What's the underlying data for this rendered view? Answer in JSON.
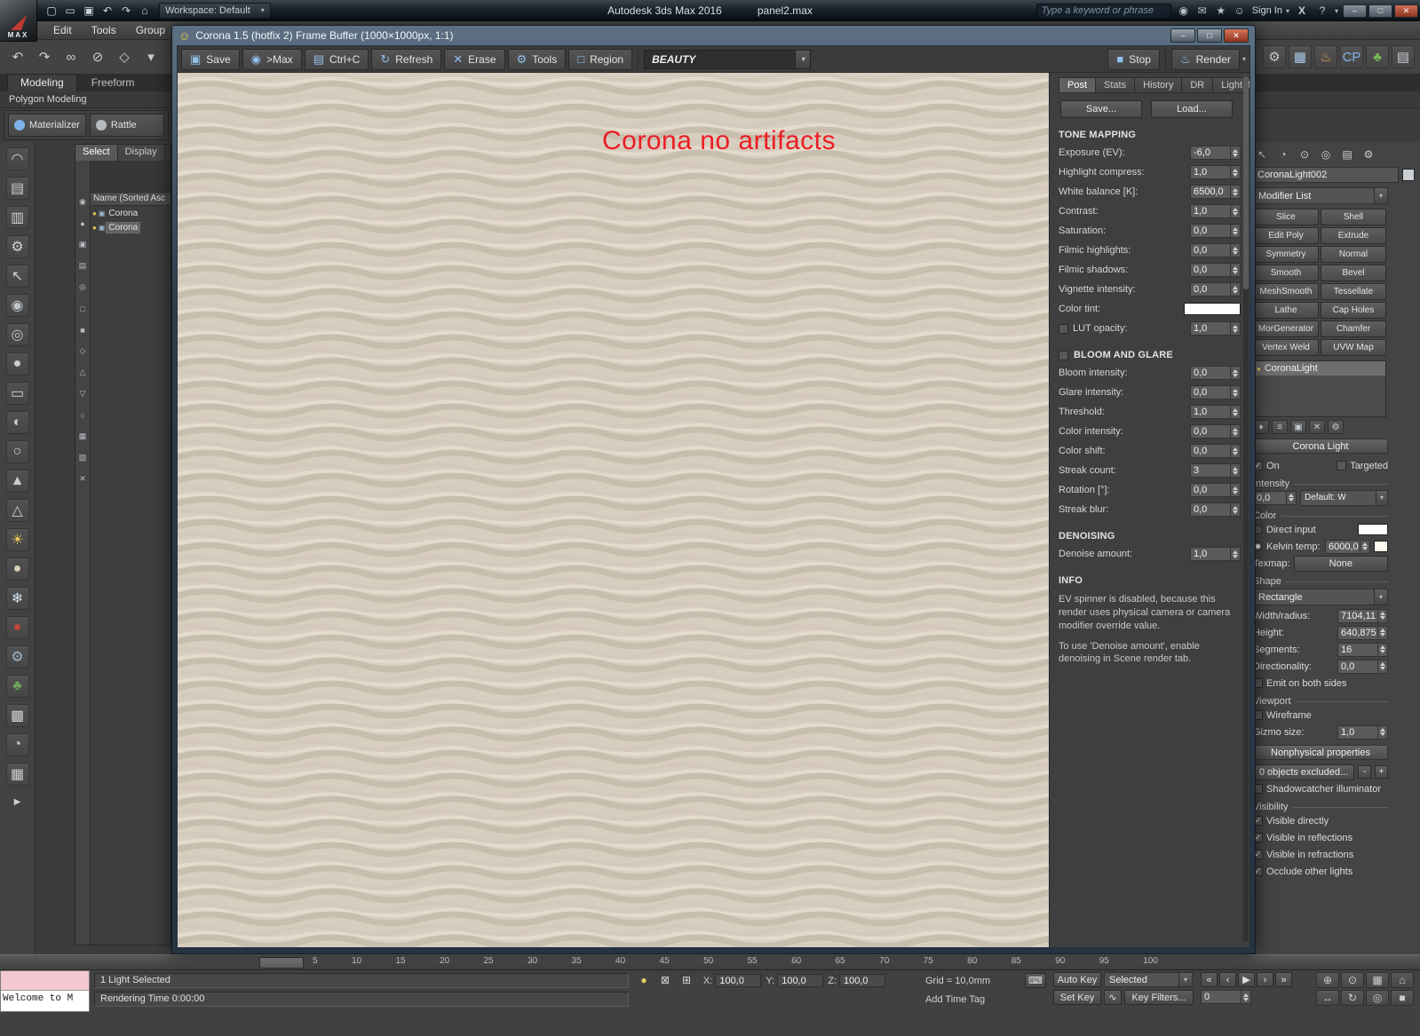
{
  "titlebar": {
    "logo": "MAX",
    "workspace_label": "Workspace: Default",
    "app_title": "Autodesk 3ds Max 2016",
    "doc_title": "panel2.max",
    "search_placeholder": "Type a keyword or phrase",
    "sign_in": "Sign In",
    "exchange": "X",
    "help": "?",
    "qat_icons": [
      {
        "name": "new-file-icon",
        "glyph": "▢"
      },
      {
        "name": "open-file-icon",
        "glyph": "▭"
      },
      {
        "name": "save-file-icon",
        "glyph": "▣"
      },
      {
        "name": "undo-icon",
        "glyph": "↶"
      },
      {
        "name": "redo-icon",
        "glyph": "↷"
      },
      {
        "name": "project-folder-icon",
        "glyph": "⌂"
      }
    ],
    "right_icons": [
      {
        "name": "search-icon",
        "glyph": "◉"
      },
      {
        "name": "communication-center-icon",
        "glyph": "✉"
      },
      {
        "name": "favorites-icon",
        "glyph": "★"
      },
      {
        "name": "user-icon",
        "glyph": "☺"
      }
    ],
    "window_buttons": [
      {
        "name": "app-minimize-button",
        "glyph": "–"
      },
      {
        "name": "app-maximize-button",
        "glyph": "□"
      },
      {
        "name": "app-close-button",
        "glyph": "✕",
        "close": true
      }
    ]
  },
  "menubar": {
    "items": [
      {
        "label": "Edit"
      },
      {
        "label": "Tools"
      },
      {
        "label": "Group"
      }
    ]
  },
  "toolbar": {
    "left_icons": [
      {
        "name": "undo-icon",
        "glyph": "↶"
      },
      {
        "name": "redo-icon",
        "glyph": "↷"
      },
      {
        "name": "select-and-link-icon",
        "glyph": "∞"
      },
      {
        "name": "unlink-selection-icon",
        "glyph": "⊘"
      },
      {
        "name": "bind-to-spacewarp-icon",
        "glyph": "◇"
      },
      {
        "name": "selection-filter-icon",
        "glyph": "▾"
      }
    ],
    "right_icons": [
      {
        "name": "render-setup-icon",
        "glyph": "⚙",
        "color": "#bfc7cd"
      },
      {
        "name": "rendered-frame-window-icon",
        "glyph": "▦",
        "color": "#a8c9e8"
      },
      {
        "name": "render-production-icon",
        "glyph": "♨",
        "color": "#e0a54c"
      },
      {
        "name": "cp-icon",
        "glyph": "CP",
        "color": "#7fb3e8"
      },
      {
        "name": "environment-icon",
        "glyph": "♣",
        "color": "#74b35a"
      },
      {
        "name": "layer-manager-icon",
        "glyph": "▤",
        "color": "#c9ced2"
      }
    ]
  },
  "ribbon": {
    "tabs": [
      {
        "label": "Modeling",
        "active": true
      },
      {
        "label": "Freeform",
        "active": false
      }
    ],
    "section_label": "Polygon Modeling",
    "tools": [
      {
        "label": "Materializer",
        "color": "#7fb3e8"
      },
      {
        "label": "Rattle",
        "color": "#b8bcc0"
      }
    ]
  },
  "left_toolbar": {
    "expander": "▶",
    "icons": [
      {
        "name": "tool-icon-arc",
        "glyph": "◠",
        "color": "#cfcfcf"
      },
      {
        "name": "tool-icon-panel",
        "glyph": "▤",
        "color": "#cfcfcf"
      },
      {
        "name": "tool-icon-sheet",
        "glyph": "▥",
        "color": "#cfcfcf"
      },
      {
        "name": "tool-icon-gear",
        "glyph": "⚙",
        "color": "#cfcfcf"
      },
      {
        "name": "tool-icon-cursor",
        "glyph": "↖",
        "color": "#cfcfcf"
      },
      {
        "name": "tool-icon-sphere",
        "glyph": "◉",
        "color": "#bfc6cc"
      },
      {
        "name": "tool-icon-ring",
        "glyph": "◎",
        "color": "#bfc6cc"
      },
      {
        "name": "tool-icon-ball",
        "glyph": "●",
        "color": "#c8cdd2"
      },
      {
        "name": "tool-icon-box",
        "glyph": "▭",
        "color": "#cfcfcf"
      },
      {
        "name": "tool-icon-half-sphere",
        "glyph": "◐",
        "color": "#c8cdd2"
      },
      {
        "name": "tool-icon-circle",
        "glyph": "○",
        "color": "#cfcfcf"
      },
      {
        "name": "tool-icon-pyramid",
        "glyph": "▲",
        "color": "#c8cdd2"
      },
      {
        "name": "tool-icon-cone",
        "glyph": "△",
        "color": "#cfcfcf"
      },
      {
        "name": "tool-icon-sun",
        "glyph": "☀",
        "color": "#e6c75a"
      },
      {
        "name": "tool-icon-sand-sphere",
        "glyph": "●",
        "color": "#d9cfb6"
      },
      {
        "name": "tool-icon-snow",
        "glyph": "❄",
        "color": "#cfe2f2"
      },
      {
        "name": "tool-icon-red-sphere",
        "glyph": "●",
        "color": "#c2463a"
      },
      {
        "name": "tool-icon-gear2",
        "glyph": "⚙",
        "color": "#9fb5c6"
      },
      {
        "name": "tool-icon-plant",
        "glyph": "♣",
        "color": "#6da45a"
      },
      {
        "name": "tool-icon-grid",
        "glyph": "▩",
        "color": "#cfcfcf"
      },
      {
        "name": "tool-icon-clock",
        "glyph": "◔",
        "color": "#cfcfcf"
      },
      {
        "name": "tool-icon-cells",
        "glyph": "▦",
        "color": "#cfcfcf"
      }
    ]
  },
  "scene_explorer": {
    "tabs": [
      {
        "label": "Select",
        "active": true
      },
      {
        "label": "Display",
        "active": false
      }
    ],
    "column_header": "Name (Sorted Asc",
    "strip_icons": [
      {
        "name": "explorer-filter-icon-1",
        "glyph": "◉"
      },
      {
        "name": "explorer-filter-icon-2",
        "glyph": "●"
      },
      {
        "name": "explorer-filter-icon-3",
        "glyph": "▣"
      },
      {
        "name": "explorer-filter-icon-4",
        "glyph": "▤"
      },
      {
        "name": "explorer-filter-icon-5",
        "glyph": "◎"
      },
      {
        "name": "explorer-filter-icon-6",
        "glyph": "□"
      },
      {
        "name": "explorer-filter-icon-7",
        "glyph": "■"
      },
      {
        "name": "explorer-filter-icon-8",
        "glyph": "◇"
      },
      {
        "name": "explorer-filter-icon-9",
        "glyph": "△"
      },
      {
        "name": "explorer-filter-icon-10",
        "glyph": "▽"
      },
      {
        "name": "explorer-filter-icon-11",
        "glyph": "○"
      },
      {
        "name": "explorer-filter-icon-12",
        "glyph": "▦"
      },
      {
        "name": "explorer-filter-icon-13",
        "glyph": "▧"
      },
      {
        "name": "explorer-filter-icon-14",
        "glyph": "✕"
      }
    ],
    "rows": [
      {
        "label": "Corona",
        "selected": false
      },
      {
        "label": "Corona",
        "selected": true
      }
    ]
  },
  "vfb": {
    "title": "Corona 1.5 (hotfix 2) Frame Buffer (1000×1000px, 1:1)",
    "window_icon": "☺",
    "window_buttons": [
      {
        "name": "vfb-minimize-button",
        "glyph": "–"
      },
      {
        "name": "vfb-maximize-button",
        "glyph": "□"
      },
      {
        "name": "vfb-close-button",
        "glyph": "✕",
        "close": true
      }
    ],
    "toolbar_buttons": [
      {
        "name": "save-button",
        "label": "Save",
        "glyph": "▣"
      },
      {
        "name": "send-to-max-button",
        "label": ">Max",
        "glyph": "◉"
      },
      {
        "name": "copy-button",
        "label": "Ctrl+C",
        "glyph": "▤"
      },
      {
        "name": "refresh-button",
        "label": "Refresh",
        "glyph": "↻"
      },
      {
        "name": "erase-button",
        "label": "Erase",
        "glyph": "✕"
      },
      {
        "name": "tools-button",
        "label": "Tools",
        "glyph": "⚙"
      },
      {
        "name": "region-button",
        "label": "Region",
        "glyph": "□"
      }
    ],
    "channel_value": "BEAUTY",
    "stop_label": "Stop",
    "render_label": "Render",
    "overlay_text": "Corona no artifacts",
    "tabs": [
      {
        "label": "Post",
        "active": true
      },
      {
        "label": "Stats",
        "active": false
      },
      {
        "label": "History",
        "active": false
      },
      {
        "label": "DR",
        "active": false
      },
      {
        "label": "LightMix",
        "active": false
      }
    ],
    "post": {
      "save_button": "Save...",
      "load_button": "Load...",
      "tone_mapping": {
        "header": "TONE MAPPING",
        "rows": [
          {
            "label": "Exposure (EV):",
            "value": "-6,0"
          },
          {
            "label": "Highlight compress:",
            "value": "1,0"
          },
          {
            "label": "White balance [K]:",
            "value": "6500,0"
          },
          {
            "label": "Contrast:",
            "value": "1,0"
          },
          {
            "label": "Saturation:",
            "value": "0,0"
          },
          {
            "label": "Filmic highlights:",
            "value": "0,0"
          },
          {
            "label": "Filmic shadows:",
            "value": "0,0"
          },
          {
            "label": "Vignette intensity:",
            "value": "0,0"
          },
          {
            "label": "Color tint:",
            "is_color": true,
            "color": "#ffffff"
          },
          {
            "label": "LUT opacity:",
            "value": "1,0",
            "has_check": true
          }
        ]
      },
      "bloom_glare": {
        "header": "BLOOM AND GLARE",
        "rows": [
          {
            "label": "Bloom intensity:",
            "value": "0,0"
          },
          {
            "label": "Glare intensity:",
            "value": "0,0"
          },
          {
            "label": "Threshold:",
            "value": "1,0"
          },
          {
            "label": "Color intensity:",
            "value": "0,0"
          },
          {
            "label": "Color shift:",
            "value": "0,0"
          },
          {
            "label": "Streak count:",
            "value": "3"
          },
          {
            "label": "Rotation [°]:",
            "value": "0,0"
          },
          {
            "label": "Streak blur:",
            "value": "0,0"
          }
        ]
      },
      "denoising": {
        "header": "DENOISING",
        "rows": [
          {
            "label": "Denoise amount:",
            "value": "1,0"
          }
        ]
      },
      "info": {
        "header": "INFO",
        "paragraphs": [
          "EV spinner is disabled, because this render uses physical camera or camera modifier override value.",
          "To use 'Denoise amount', enable denoising in Scene render tab."
        ]
      }
    }
  },
  "command_panel": {
    "tab_icons": [
      {
        "name": "create-tab-icon",
        "glyph": "↖"
      },
      {
        "name": "modify-tab-icon",
        "glyph": "◔"
      },
      {
        "name": "hierarchy-tab-icon",
        "glyph": "⊙"
      },
      {
        "name": "motion-tab-icon",
        "glyph": "◎"
      },
      {
        "name": "display-tab-icon",
        "glyph": "▤"
      },
      {
        "name": "utilities-tab-icon",
        "glyph": "⚙"
      }
    ],
    "object_name": "CoronaLight002",
    "modifier_list_label": "Modifier List",
    "modifier_buttons": [
      {
        "label": "Slice"
      },
      {
        "label": "Shell"
      },
      {
        "label": "Edit Poly"
      },
      {
        "label": "Extrude"
      },
      {
        "label": "Symmetry"
      },
      {
        "label": "Normal"
      },
      {
        "label": "Smooth"
      },
      {
        "label": "Bevel"
      },
      {
        "label": "MeshSmooth"
      },
      {
        "label": "Tessellate"
      },
      {
        "label": "Lathe"
      },
      {
        "label": "Cap Holes"
      },
      {
        "label": "MorGenerator"
      },
      {
        "label": "Chamfer"
      },
      {
        "label": "Vertex Weld"
      },
      {
        "label": "UVW Map"
      }
    ],
    "stack_items": [
      {
        "label": "CoronaLight",
        "selected": true
      }
    ],
    "stack_tool_icons": [
      {
        "name": "pin-stack-icon",
        "glyph": "♦"
      },
      {
        "name": "show-end-result-icon",
        "glyph": "≡"
      },
      {
        "name": "make-unique-icon",
        "glyph": "▣"
      },
      {
        "name": "remove-modifier-icon",
        "glyph": "✕"
      },
      {
        "name": "configure-modifier-sets-icon",
        "glyph": "⚙"
      }
    ],
    "light": {
      "title": "Corona Light",
      "on_label": "On",
      "on_checked": true,
      "targeted_label": "Targeted",
      "targeted_checked": false,
      "intensity_label": "Intensity",
      "intensity_value": "0,0",
      "intensity_unit": "Default: W",
      "color_label": "Color",
      "direct_input_label": "Direct input",
      "direct_color": "#ffffff",
      "kelvin_label": "Kelvin temp:",
      "kelvin_value": "6000,0",
      "kelvin_color": "#fff8ee",
      "texmap_label": "Texmap:",
      "texmap_button": "None",
      "shape_label": "Shape",
      "shape_value": "Rectangle",
      "shape_fields": [
        {
          "label": "Width/radius:",
          "value": "7104,11"
        },
        {
          "label": "Height:",
          "value": "640,875"
        },
        {
          "label": "Segments:",
          "value": "16"
        },
        {
          "label": "Directionality:",
          "value": "0,0"
        }
      ],
      "emit_label": "Emit on both sides",
      "emit_checked": false,
      "viewport_label": "Viewport",
      "wireframe_label": "Wireframe",
      "wireframe_checked": false,
      "gizmo_label": "Gizmo size:",
      "gizmo_value": "1,0"
    },
    "nonphysical": {
      "title": "Nonphysical properties",
      "exclude_button": "0 objects excluded...",
      "shadowcatcher_label": "Shadowcatcher illuminator",
      "shadowcatcher_checked": false
    },
    "visibility": {
      "title": "Visibility",
      "options": [
        {
          "label": "Visible directly",
          "checked": true
        },
        {
          "label": "Visible in reflections",
          "checked": true
        },
        {
          "label": "Visible in refractions",
          "checked": true
        },
        {
          "label": "Occlude other lights",
          "checked": true
        }
      ]
    }
  },
  "timeline": {
    "ticks": [
      {
        "label": "5"
      },
      {
        "label": "10"
      },
      {
        "label": "15"
      },
      {
        "label": "20"
      },
      {
        "label": "25"
      },
      {
        "label": "30"
      },
      {
        "label": "35"
      },
      {
        "label": "40"
      },
      {
        "label": "45"
      },
      {
        "label": "50"
      },
      {
        "label": "55"
      },
      {
        "label": "60"
      },
      {
        "label": "65"
      },
      {
        "label": "70"
      },
      {
        "label": "75"
      },
      {
        "label": "80"
      },
      {
        "label": "85"
      },
      {
        "label": "90"
      },
      {
        "label": "95"
      },
      {
        "label": "100"
      }
    ]
  },
  "statusbar": {
    "listener_text": "Welcome to M",
    "selection_status": "1 Light Selected",
    "prompt_line": "Rendering Time  0:00:00",
    "status_icons": [
      {
        "name": "isolate-selection-icon",
        "glyph": "●",
        "color": "#e8d060"
      },
      {
        "name": "selection-lock-icon",
        "glyph": "⊠",
        "color": "#d5d9dd"
      },
      {
        "name": "absolute-mode-icon",
        "glyph": "⊞",
        "color": "#d5d9dd"
      }
    ],
    "coords": [
      {
        "label": "X:",
        "value": "100,0"
      },
      {
        "label": "Y:",
        "value": "100,0"
      },
      {
        "label": "Z:",
        "value": "100,0"
      }
    ],
    "grid_text": "Grid = 10,0mm",
    "time_tag": "Add Time Tag",
    "auto_key": "Auto Key",
    "set_key": "Set Key",
    "selection_set": "Selected",
    "key_filters": "Key Filters...",
    "curve_icon": "∿",
    "time_value": "0",
    "playback_icons": [
      {
        "name": "go-to-start-button",
        "glyph": "«"
      },
      {
        "name": "previous-frame-button",
        "glyph": "‹"
      },
      {
        "name": "play-button",
        "glyph": "▶"
      },
      {
        "name": "next-frame-button",
        "glyph": "›"
      },
      {
        "name": "go-to-end-button",
        "glyph": "»"
      }
    ],
    "nav_icons": [
      {
        "name": "zoom-icon",
        "glyph": "⊕"
      },
      {
        "name": "zoom-all-icon",
        "glyph": "⊙"
      },
      {
        "name": "zoom-extents-icon",
        "glyph": "▦"
      },
      {
        "name": "zoom-region-icon",
        "glyph": "⌂"
      },
      {
        "name": "pan-icon",
        "glyph": "↔"
      },
      {
        "name": "orbit-icon",
        "glyph": "↻"
      },
      {
        "name": "maximize-viewport-icon",
        "glyph": "◎"
      },
      {
        "name": "viewport-layout-icon",
        "glyph": "■"
      }
    ]
  }
}
